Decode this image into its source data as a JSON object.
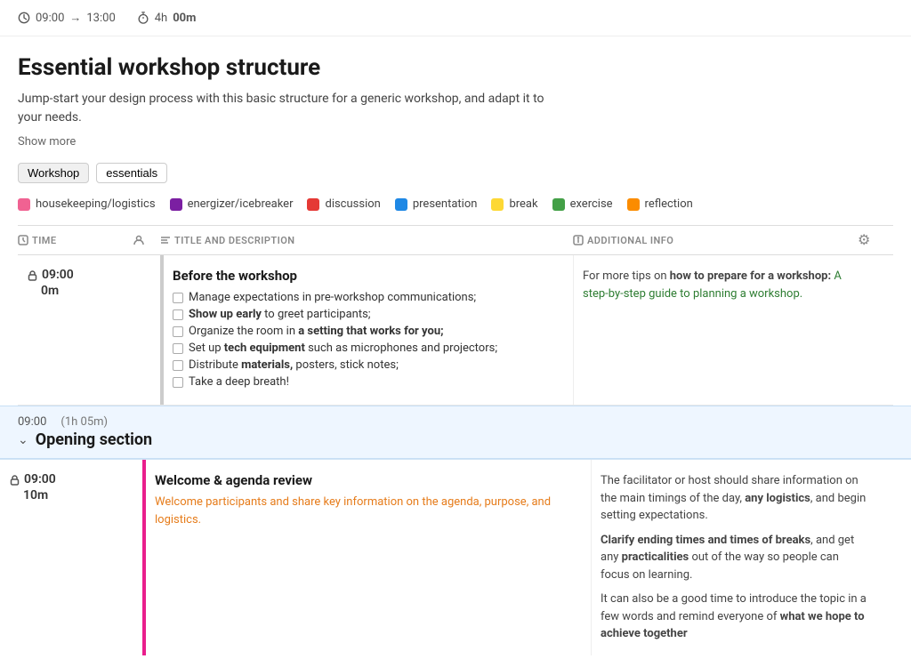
{
  "topbar": {
    "time_start": "09:00",
    "arrow": "→",
    "time_end": "13:00",
    "duration_label": "4h",
    "duration_minutes": "00m"
  },
  "page": {
    "title": "Essential workshop structure",
    "description": "Jump-start your design process with this basic structure for a generic workshop,  and adapt it to your needs.",
    "show_more": "Show more"
  },
  "tags": [
    {
      "label": "Workshop",
      "active": true
    },
    {
      "label": "essentials",
      "active": false
    }
  ],
  "legend": [
    {
      "label": "housekeeping/logistics",
      "color": "#f06292"
    },
    {
      "label": "energizer/icebreaker",
      "color": "#7b1fa2"
    },
    {
      "label": "discussion",
      "color": "#e53935"
    },
    {
      "label": "presentation",
      "color": "#1e88e5"
    },
    {
      "label": "break",
      "color": "#fdd835"
    },
    {
      "label": "exercise",
      "color": "#43a047"
    },
    {
      "label": "reflection",
      "color": "#fb8c00"
    }
  ],
  "table_headers": {
    "time": "TIME",
    "facilitator": "",
    "title_desc": "TITLE AND DESCRIPTION",
    "additional_info": "ADDITIONAL INFO"
  },
  "before_workshop": {
    "time": "09:00",
    "duration": "0m",
    "title": "Before the workshop",
    "checklist": [
      {
        "text": "Manage expectations in pre-workshop communications;"
      },
      {
        "bold_part": "Show up early",
        "text": " to greet participants;"
      },
      {
        "text": "Organize the room in ",
        "bold_part": "a setting that works for you;"
      },
      {
        "text": "Set up ",
        "bold_part": "tech equipment",
        "rest": " such as microphones and projectors;"
      },
      {
        "text": "Distribute ",
        "bold_part": "materials,",
        "rest": " posters, stick notes;"
      },
      {
        "text": "Take a deep breath!"
      }
    ],
    "info_text": "For more tips on ",
    "info_bold": "how to prepare for a workshop:",
    "info_link": "A step-by-step guide to planning a workshop."
  },
  "opening_section": {
    "time": "09:00",
    "duration": "(1h 05m)",
    "title": "Opening section",
    "items": [
      {
        "time": "09:00",
        "duration": "10m",
        "title": "Welcome & agenda review",
        "description": "Welcome participants and share key information on the agenda, purpose, and logistics.",
        "info_paragraph1": "The facilitator or host should share information on the main timings of the day, ",
        "info_bold1": "any logistics",
        "info_after1": ", and begin setting expectations.",
        "info_paragraph2_bold": "Clarify ending times and times of breaks",
        "info_paragraph2": ", and get any ",
        "info_bold2": "practicalities",
        "info_after2": " out of the way so people can focus on learning.",
        "info_paragraph3": "It can also be a good time to introduce the topic in a few words and remind everyone of ",
        "info_bold3": "what we hope to achieve together"
      }
    ]
  }
}
